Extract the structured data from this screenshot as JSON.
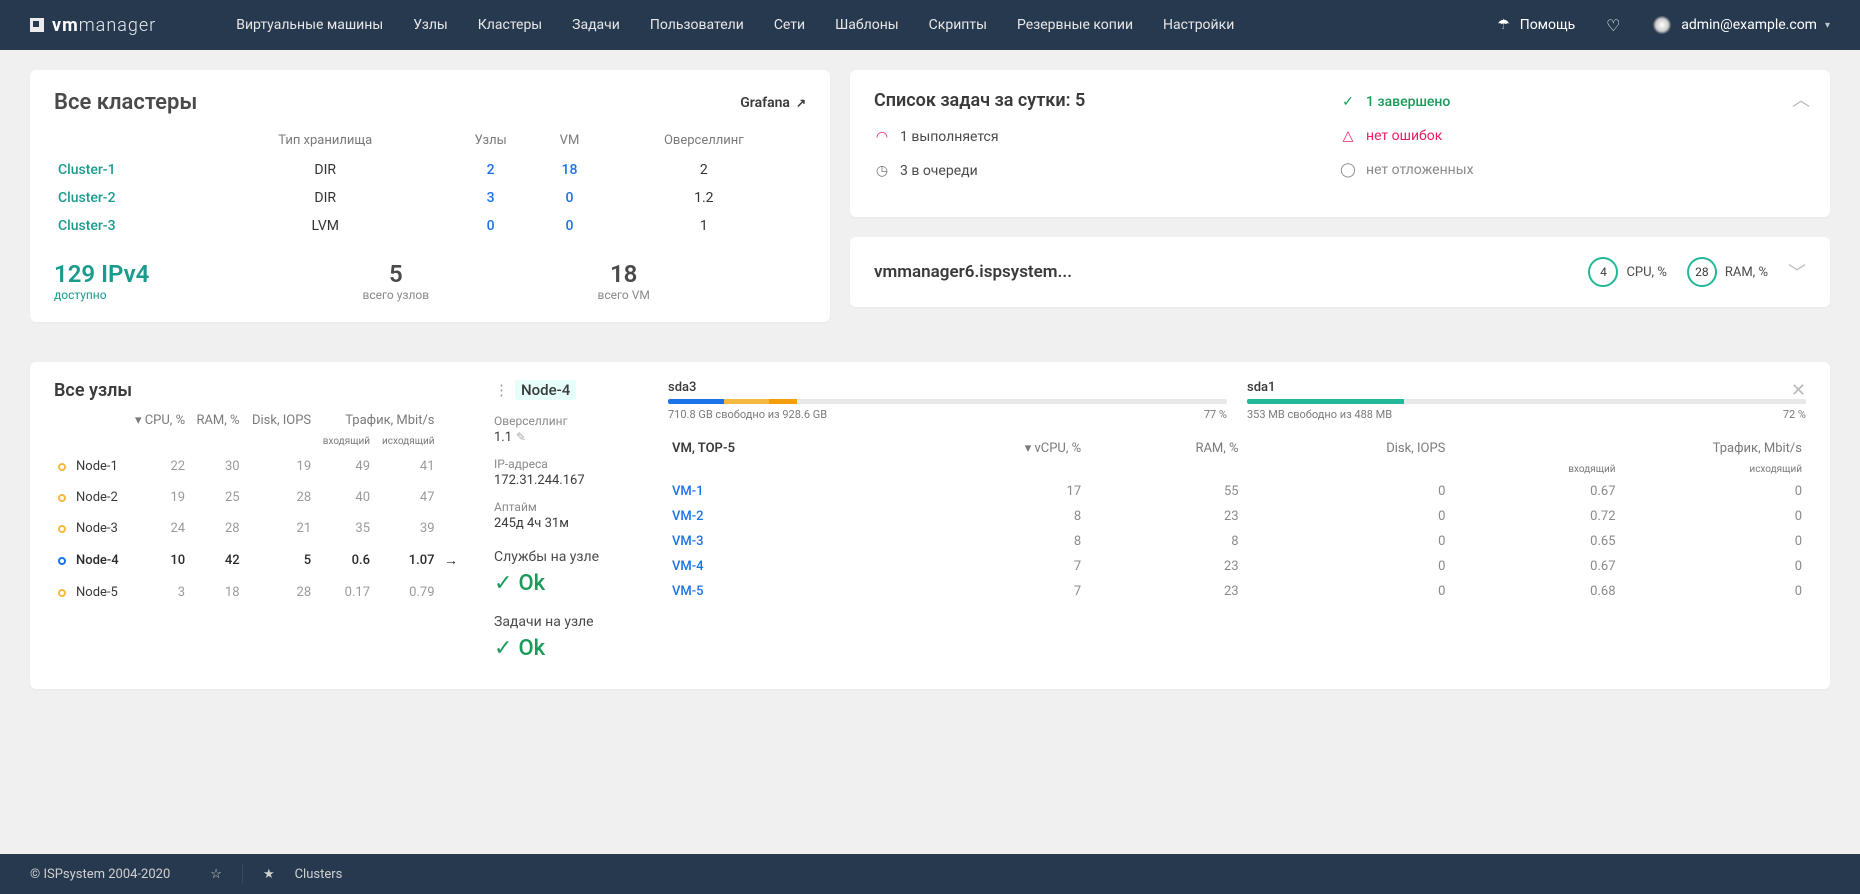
{
  "brand": {
    "vm": "vm",
    "manager": "manager"
  },
  "nav": [
    "Виртуальные машины",
    "Узлы",
    "Кластеры",
    "Задачи",
    "Пользователи",
    "Сети",
    "Шаблоны",
    "Скрипты",
    "Резервные копии",
    "Настройки"
  ],
  "help": "Помощь",
  "user": "admin@example.com",
  "clusters": {
    "title": "Все кластеры",
    "grafana": "Grafana",
    "headers": [
      "",
      "Тип хранилища",
      "Узлы",
      "VM",
      "Оверселлинг"
    ],
    "rows": [
      {
        "name": "Cluster-1",
        "storage": "DIR",
        "nodes": "2",
        "vm": "18",
        "over": "2"
      },
      {
        "name": "Cluster-2",
        "storage": "DIR",
        "nodes": "3",
        "vm": "0",
        "over": "1.2"
      },
      {
        "name": "Cluster-3",
        "storage": "LVM",
        "nodes": "0",
        "vm": "0",
        "over": "1"
      }
    ],
    "ipv4": {
      "n": "129 IPv4",
      "label": "доступно"
    },
    "totnodes": {
      "n": "5",
      "label": "всего узлов"
    },
    "totvm": {
      "n": "18",
      "label": "всего VM"
    }
  },
  "tasks": {
    "title": "Список задач за сутки: 5",
    "running": "1 выполняется",
    "queued": "3 в очереди",
    "done": "1 завершено",
    "noerr": "нет ошибок",
    "nodelay": "нет отложенных"
  },
  "host": {
    "name": "vmmanager6.ispsystem...",
    "cpu": "4",
    "cpul": "CPU, %",
    "ram": "28",
    "raml": "RAM, %"
  },
  "nodes": {
    "title": "Все узлы",
    "headers": [
      "",
      "CPU, %",
      "RAM, %",
      "Disk, IOPS"
    ],
    "traffic": "Трафик, Mbit/s",
    "tin": "входящий",
    "tout": "исходящий",
    "rows": [
      {
        "name": "Node-1",
        "cpu": "22",
        "ram": "30",
        "disk": "19",
        "in": "49",
        "out": "41",
        "sel": false,
        "dot": "orange"
      },
      {
        "name": "Node-2",
        "cpu": "19",
        "ram": "25",
        "disk": "28",
        "in": "40",
        "out": "47",
        "sel": false,
        "dot": "orange"
      },
      {
        "name": "Node-3",
        "cpu": "24",
        "ram": "28",
        "disk": "21",
        "in": "35",
        "out": "39",
        "sel": false,
        "dot": "orange"
      },
      {
        "name": "Node-4",
        "cpu": "10",
        "ram": "42",
        "disk": "5",
        "in": "0.6",
        "out": "1.07",
        "sel": true,
        "dot": "blue"
      },
      {
        "name": "Node-5",
        "cpu": "3",
        "ram": "18",
        "disk": "28",
        "in": "0.17",
        "out": "0.79",
        "sel": false,
        "dot": "orange"
      }
    ]
  },
  "detail": {
    "name": "Node-4",
    "over_k": "Оверселлинг",
    "over_v": "1.1",
    "ip_k": "IP-адреса",
    "ip_v": "172.31.244.167",
    "up_k": "Аптайм",
    "up_v": "245д 4ч 31м",
    "serv_k": "Службы на узле",
    "ok": "Ok",
    "task_k": "Задачи на узле",
    "disks": [
      {
        "name": "sda3",
        "free": "710.8 GB свободно из 928.6 GB",
        "pct": "77 %",
        "segs": [
          [
            "#1a73e8",
            10
          ],
          [
            "#f5b942",
            8
          ],
          [
            "#f59e0b",
            5
          ]
        ]
      },
      {
        "name": "sda1",
        "free": "353 MB свободно из 488 MB",
        "pct": "72 %",
        "segs": [
          [
            "#23b89a",
            28
          ]
        ]
      }
    ],
    "vms": {
      "title": "VM, TOP-5",
      "headers": [
        "",
        "vCPU, %",
        "RAM, %",
        "Disk, IOPS"
      ],
      "traffic": "Трафик, Mbit/s",
      "tin": "входящий",
      "tout": "исходящий",
      "rows": [
        {
          "name": "VM-1",
          "cpu": "17",
          "ram": "55",
          "disk": "0",
          "in": "0.67",
          "out": "0"
        },
        {
          "name": "VM-2",
          "cpu": "8",
          "ram": "23",
          "disk": "0",
          "in": "0.72",
          "out": "0"
        },
        {
          "name": "VM-3",
          "cpu": "8",
          "ram": "8",
          "disk": "0",
          "in": "0.65",
          "out": "0"
        },
        {
          "name": "VM-4",
          "cpu": "7",
          "ram": "23",
          "disk": "0",
          "in": "0.67",
          "out": "0"
        },
        {
          "name": "VM-5",
          "cpu": "7",
          "ram": "23",
          "disk": "0",
          "in": "0.68",
          "out": "0"
        }
      ]
    }
  },
  "footer": {
    "copy": "© ISPsystem 2004-2020",
    "clusters": "Clusters"
  }
}
